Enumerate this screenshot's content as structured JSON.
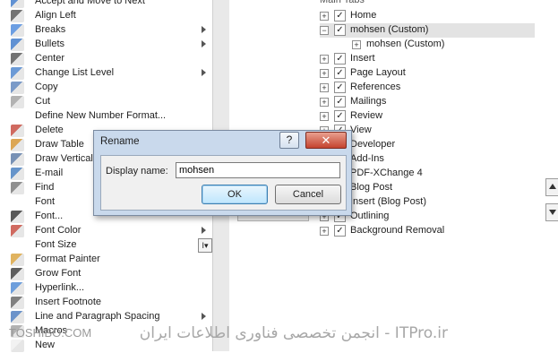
{
  "commands": [
    {
      "label": "Accept and Move to Next",
      "icon": "accept-icon"
    },
    {
      "label": "Align Left",
      "icon": "align-left-icon"
    },
    {
      "label": "Breaks",
      "icon": "breaks-icon",
      "submenu": true
    },
    {
      "label": "Bullets",
      "icon": "bullets-icon",
      "submenu": true
    },
    {
      "label": "Center",
      "icon": "center-icon"
    },
    {
      "label": "Change List Level",
      "icon": "list-level-icon",
      "submenu": true
    },
    {
      "label": "Copy",
      "icon": "copy-icon"
    },
    {
      "label": "Cut",
      "icon": "cut-icon"
    },
    {
      "label": "Define New Number Format...",
      "icon": ""
    },
    {
      "label": "Delete",
      "icon": "delete-icon"
    },
    {
      "label": "Draw Table",
      "icon": "draw-table-icon"
    },
    {
      "label": "Draw Vertical",
      "icon": "draw-vertical-icon"
    },
    {
      "label": "E-mail",
      "icon": "email-icon"
    },
    {
      "label": "Find",
      "icon": "find-icon"
    },
    {
      "label": "Font",
      "icon": ""
    },
    {
      "label": "Font...",
      "icon": "font-icon"
    },
    {
      "label": "Font Color",
      "icon": "font-color-icon",
      "submenu": true
    },
    {
      "label": "Font Size",
      "icon": "",
      "dropdown": true
    },
    {
      "label": "Format Painter",
      "icon": "format-painter-icon"
    },
    {
      "label": "Grow Font",
      "icon": "grow-font-icon"
    },
    {
      "label": "Hyperlink...",
      "icon": "hyperlink-icon"
    },
    {
      "label": "Insert Footnote",
      "icon": "footnote-icon"
    },
    {
      "label": "Line and Paragraph Spacing",
      "icon": "line-spacing-icon",
      "submenu": true
    },
    {
      "label": "Macros",
      "icon": "macros-icon"
    },
    {
      "label": "New",
      "icon": "new-icon"
    }
  ],
  "tree": {
    "header": "Main Tabs",
    "items": [
      {
        "label": "Home",
        "level": 0,
        "checked": true,
        "expander": "+"
      },
      {
        "label": "mohsen (Custom)",
        "level": 0,
        "checked": true,
        "expander": "−",
        "selected": true
      },
      {
        "label": "mohsen (Custom)",
        "level": 1,
        "checked": false,
        "expander": "+"
      },
      {
        "label": "Insert",
        "level": 0,
        "checked": true,
        "expander": "+"
      },
      {
        "label": "Page Layout",
        "level": 0,
        "checked": true,
        "expander": "+"
      },
      {
        "label": "References",
        "level": 0,
        "checked": true,
        "expander": "+"
      },
      {
        "label": "Mailings",
        "level": 0,
        "checked": true,
        "expander": "+"
      },
      {
        "label": "Review",
        "level": 0,
        "checked": true,
        "expander": "+"
      },
      {
        "label": "View",
        "level": 0,
        "checked": true,
        "expander": "+"
      },
      {
        "label": "Developer",
        "level": 0,
        "checked": true,
        "expander": "+"
      },
      {
        "label": "Add-Ins",
        "level": 0,
        "checked": true,
        "expander": "+"
      },
      {
        "label": "PDF-XChange 4",
        "level": 0,
        "checked": true,
        "expander": "+"
      },
      {
        "label": "Blog Post",
        "level": 0,
        "checked": true,
        "expander": "+"
      },
      {
        "label": "Insert (Blog Post)",
        "level": 0,
        "checked": true,
        "expander": "+"
      },
      {
        "label": "Outlining",
        "level": 0,
        "checked": true,
        "expander": "+"
      },
      {
        "label": "Background Removal",
        "level": 0,
        "checked": true,
        "expander": "+"
      }
    ]
  },
  "dialog": {
    "title": "Rename",
    "help": "?",
    "close": "✕",
    "field_label": "Display name:",
    "field_value": "mohsen",
    "ok": "OK",
    "cancel": "Cancel"
  },
  "watermark": {
    "text": "انجمن تخصصی فناوری اطلاعات ایران - ITPro.ir",
    "left": "TOSHIBO.COM"
  }
}
